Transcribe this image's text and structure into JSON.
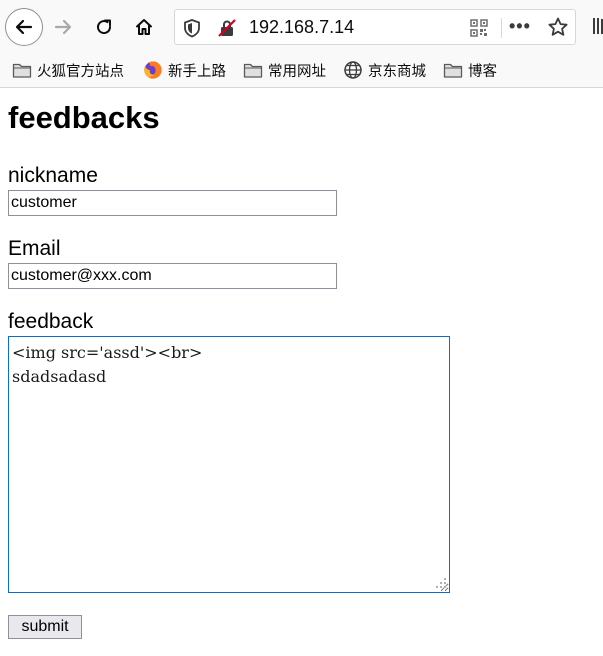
{
  "browser": {
    "url": "192.168.7.14",
    "buttons": [
      "back",
      "forward",
      "reload",
      "home"
    ],
    "more_label": "•••"
  },
  "bookmarks": [
    {
      "label": "火狐官方站点",
      "icon": "folder-icon"
    },
    {
      "label": "新手上路",
      "icon": "firefox-icon"
    },
    {
      "label": "常用网址",
      "icon": "folder-icon"
    },
    {
      "label": "京东商城",
      "icon": "globe-icon"
    },
    {
      "label": "博客",
      "icon": "folder-icon"
    }
  ],
  "page": {
    "title": "feedbacks",
    "nickname_label": "nickname",
    "nickname_value": "customer",
    "email_label": "Email",
    "email_value": "customer@xxx.com",
    "feedback_label": "feedback",
    "feedback_value": "<img src='assd'><br>\nsdadsadasd",
    "submit_label": "submit"
  },
  "colors": {
    "toolbar_bg": "#f9f9fa",
    "textarea_focus": "#0a6fc7",
    "insecure_red": "#d70022"
  }
}
